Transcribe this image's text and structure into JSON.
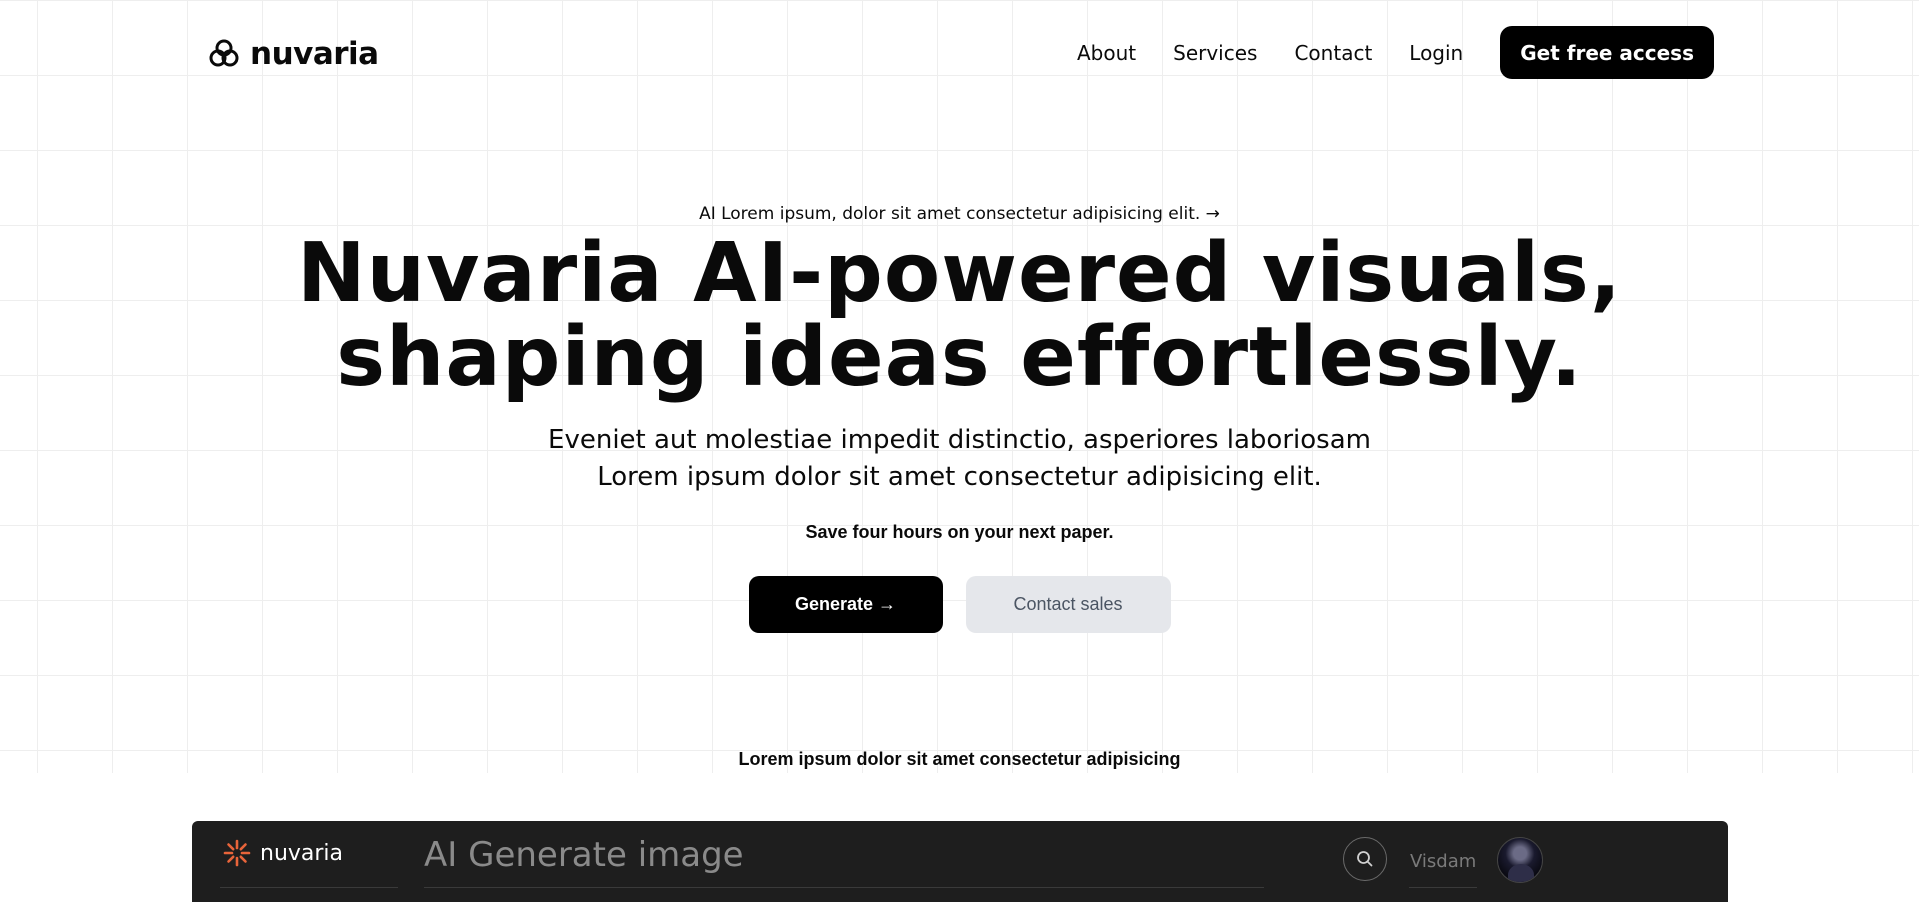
{
  "nav": {
    "brand": "nuvaria",
    "links": [
      "About",
      "Services",
      "Contact",
      "Login"
    ],
    "cta": "Get free access"
  },
  "hero": {
    "announcement": "AI Lorem ipsum, dolor sit amet consectetur adipisicing elit. →",
    "headline_line1": "Nuvaria AI-powered visuals,",
    "headline_line2": "shaping ideas effortlessly.",
    "subtext_line1": "Eveniet aut molestiae impedit distinctio, asperiores laboriosam",
    "subtext_line2": "Lorem ipsum dolor sit amet consectetur adipisicing elit.",
    "tagline": "Save four hours on your next paper.",
    "primary_button": "Generate →",
    "secondary_button": "Contact sales",
    "footer_line": "Lorem ipsum dolor sit amet consectetur adipisicing"
  },
  "app_preview": {
    "brand": "nuvaria",
    "title": "AI Generate image",
    "user_name": "Visdam",
    "icons": [
      "sunburst-logo-icon",
      "search-icon",
      "avatar"
    ]
  },
  "colors": {
    "primary": "#000000",
    "secondary_button_bg": "#e5e7eb",
    "app_bg": "#1e1e1e",
    "logo_accent": "#e8643a"
  }
}
